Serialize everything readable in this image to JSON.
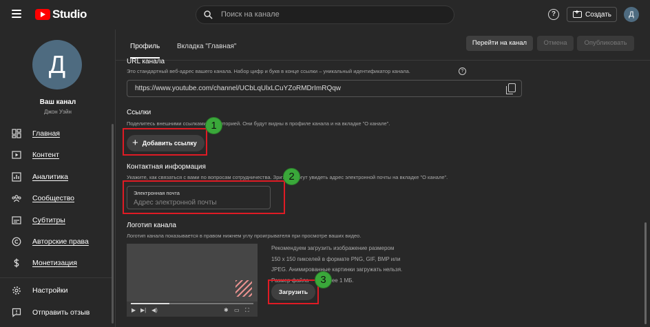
{
  "header": {
    "logo_text": "Studio",
    "search_placeholder": "Поиск на канале",
    "help_label": "?",
    "create_label": "Создать",
    "avatar_letter": "Д"
  },
  "sidebar": {
    "avatar_letter": "Д",
    "channel_title": "Ваш канал",
    "channel_owner": "Джон Уэйн",
    "items": [
      {
        "label": "Главная",
        "icon": "dashboard-icon"
      },
      {
        "label": "Контент",
        "icon": "content-icon"
      },
      {
        "label": "Аналитика",
        "icon": "analytics-icon"
      },
      {
        "label": "Сообщество",
        "icon": "community-icon"
      },
      {
        "label": "Субтитры",
        "icon": "subtitles-icon"
      },
      {
        "label": "Авторские права",
        "icon": "copyright-icon"
      },
      {
        "label": "Монетизация",
        "icon": "monetization-icon"
      }
    ],
    "settings_label": "Настройки",
    "feedback_label": "Отправить отзыв"
  },
  "tabs": [
    {
      "label": "Профиль",
      "active": true
    },
    {
      "label": "Вкладка \"Главная\"",
      "active": false
    }
  ],
  "actions": {
    "goto_channel": "Перейти на канал",
    "cancel": "Отмена",
    "publish": "Опубликовать"
  },
  "url_section": {
    "title": "URL канала",
    "description": "Это стандартный веб-адрес вашего канала. Набор цифр и букв в конце ссылки – уникальный идентификатор канала.",
    "value": "https://www.youtube.com/channel/UCbLqUlxLCuYZoRMDrImRQqw"
  },
  "links_section": {
    "title": "Ссылки",
    "description": "Поделитесь внешними ссылками с аудиторией. Они будут видны в профиле канала и на вкладке \"О канале\".",
    "add_button": "Добавить ссылку"
  },
  "contact_section": {
    "title": "Контактная информация",
    "description": "Укажите, как связаться с вами по вопросам сотрудничества. Зрители могут увидеть адрес электронной почты на вкладке \"О канале\".",
    "email_label": "Электронная почта",
    "email_placeholder": "Адрес электронной почты"
  },
  "logo_section": {
    "title": "Логотип канала",
    "description": "Логотип канала показывается в правом нижнем углу проигрывателя при просмотре ваших видео.",
    "recommendation_lines": [
      "Рекомендуем загрузить изображение размером",
      "150 x 150 пикселей в формате PNG, GIF, BMP или",
      "JPEG. Анимированные картинки загружать нельзя.",
      "Размер файла – не более 1 МБ."
    ],
    "upload_button": "Загрузить"
  },
  "annotations": {
    "badges": [
      "1",
      "2",
      "3"
    ],
    "accent_color": "#e01b24",
    "badge_color": "#3aa83a"
  }
}
